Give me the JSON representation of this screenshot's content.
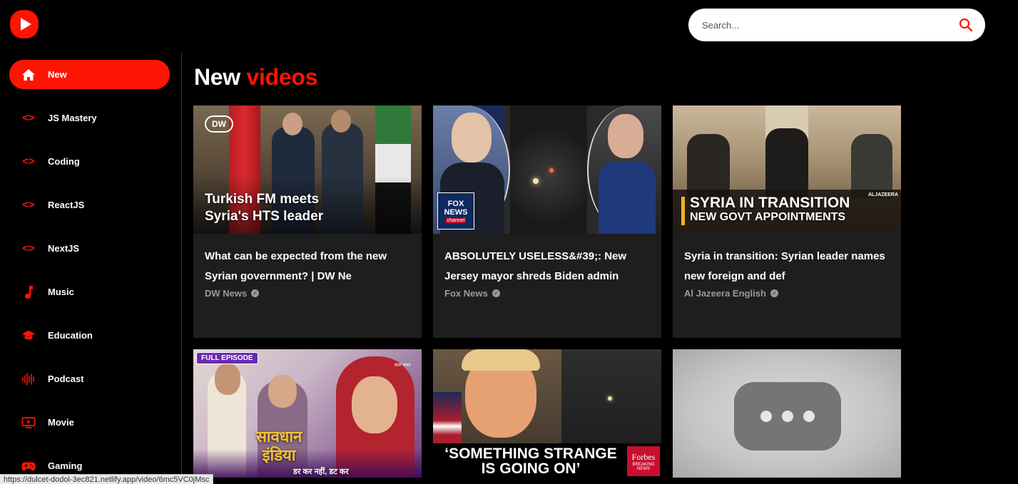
{
  "search": {
    "placeholder": "Search..."
  },
  "sidebar": {
    "items": [
      {
        "label": "New",
        "icon": "home-icon",
        "active": true
      },
      {
        "label": "JS Mastery",
        "icon": "code-icon"
      },
      {
        "label": "Coding",
        "icon": "code-icon"
      },
      {
        "label": "ReactJS",
        "icon": "code-icon"
      },
      {
        "label": "NextJS",
        "icon": "code-icon"
      },
      {
        "label": "Music",
        "icon": "music-note-icon"
      },
      {
        "label": "Education",
        "icon": "graduation-cap-icon"
      },
      {
        "label": "Podcast",
        "icon": "podcast-icon"
      },
      {
        "label": "Movie",
        "icon": "movie-icon"
      },
      {
        "label": "Gaming",
        "icon": "gamepad-icon"
      }
    ]
  },
  "page": {
    "title_main": "New",
    "title_accent": "videos"
  },
  "videos": [
    {
      "title": "What can be expected from the new Syrian government? | DW Ne",
      "channel": "DW News",
      "thumb_line1": "Turkish FM meets",
      "thumb_line2": "Syria's HTS leader",
      "thumb_logo": "DW"
    },
    {
      "title": "ABSOLUTELY USELESS&#39;: New Jersey mayor shreds Biden admin",
      "channel": "Fox News",
      "thumb_logo": "FOX NEWS",
      "thumb_logo_sub": "channel"
    },
    {
      "title": "Syria in transition: Syrian leader names new foreign and def",
      "channel": "Al Jazeera English",
      "thumb_line1": "SYRIA IN TRANSITION",
      "thumb_line2": "NEW GOVT APPOINTMENTS",
      "thumb_logo": "ALJAZEERA"
    },
    {
      "badge": "FULL EPISODE",
      "thumb_line1": "सावधान",
      "thumb_line2": "इंडिया",
      "thumb_line3": "डर कर नहीं, डट कर",
      "thumb_logo": "स्टार भारत"
    },
    {
      "thumb_line1": "‘SOMETHING STRANGE",
      "thumb_line2": "IS GOING ON’",
      "thumb_logo": "Forbes",
      "thumb_logo_sub1": "BREAKING",
      "thumb_logo_sub2": "NEWS"
    },
    {
      "placeholder": true
    }
  ],
  "status_bar": {
    "url": "https://dulcet-dodol-3ec821.netlify.app/video/6mc5VC0jMsc"
  },
  "colors": {
    "accent": "#fc1503",
    "card_bg": "#1e1e1e",
    "background": "#000000"
  }
}
